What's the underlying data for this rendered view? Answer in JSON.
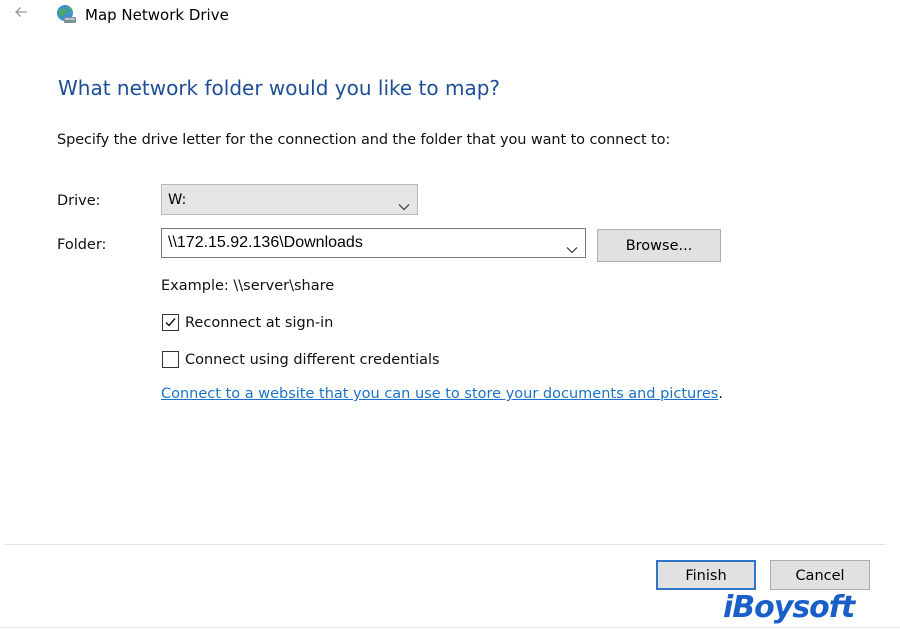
{
  "window": {
    "title": "Map Network Drive",
    "back_icon": "back-arrow-icon",
    "app_icon": "network-drive-icon"
  },
  "main": {
    "heading": "What network folder would you like to map?",
    "instruction": "Specify the drive letter for the connection and the folder that you want to connect to:"
  },
  "form": {
    "drive_label": "Drive:",
    "drive_value": "W:",
    "folder_label": "Folder:",
    "folder_value": "\\\\172.15.92.136\\Downloads",
    "browse_label": "Browse...",
    "example_text": "Example: \\\\server\\share",
    "reconnect_label": "Reconnect at sign-in",
    "reconnect_checked": true,
    "credentials_label": "Connect using different credentials",
    "credentials_checked": false,
    "website_link": "Connect to a website that you can use to store your documents and pictures",
    "link_period": "."
  },
  "footer": {
    "finish_label": "Finish",
    "cancel_label": "Cancel",
    "watermark": "iBoysoft"
  },
  "colors": {
    "heading": "#1c4f95",
    "link": "#1a73c8",
    "focus_border": "#2f76c6",
    "watermark": "#1a5fc7"
  }
}
